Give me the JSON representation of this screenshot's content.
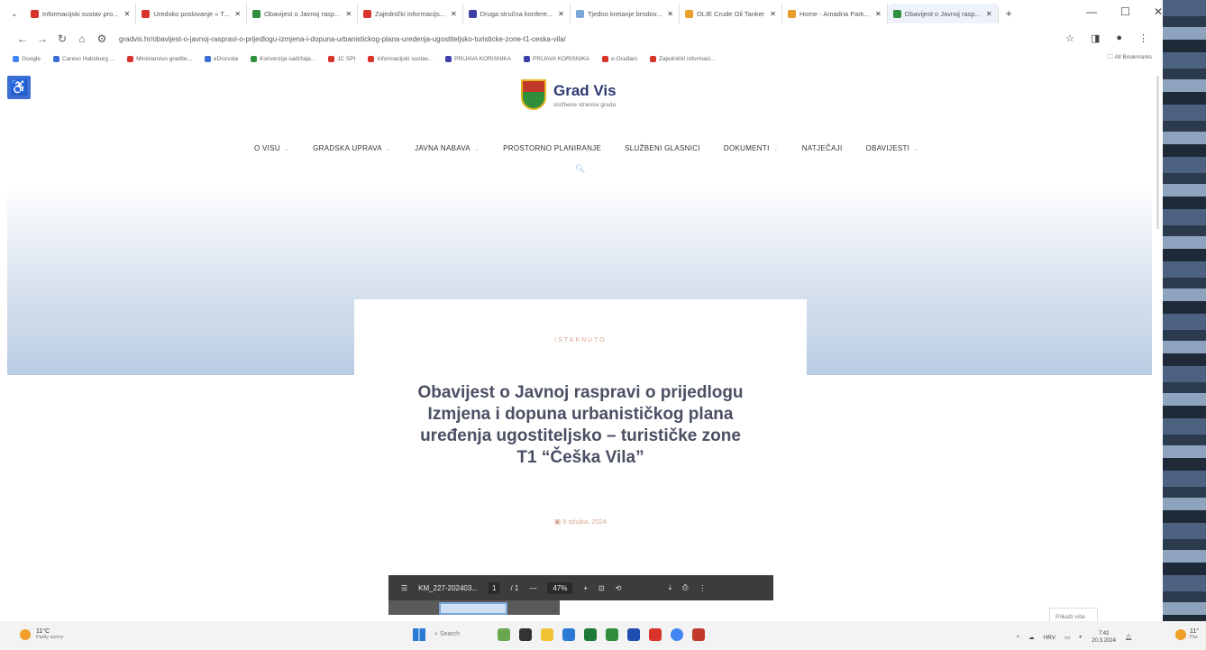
{
  "browser": {
    "tabs": [
      {
        "label": "Informacijski sustav pro...",
        "color": "#d9342b",
        "active": false
      },
      {
        "label": "Uredsko poslovanje » T...",
        "color": "#d9342b",
        "active": false
      },
      {
        "label": "Obavijest o Javnoj rasp...",
        "color": "#2f8f3a",
        "active": false
      },
      {
        "label": "Zajednički informacijs...",
        "color": "#d9342b",
        "active": false
      },
      {
        "label": "Druga stručna konfere...",
        "color": "#3b3fa8",
        "active": false
      },
      {
        "label": "Tjedno kretanje brodov...",
        "color": "#7aa6d8",
        "active": false
      },
      {
        "label": "OLIE Crude Oil Tanker",
        "color": "#e8a02a",
        "active": false
      },
      {
        "label": "Home - Amadria Park...",
        "color": "#e8a02a",
        "active": false
      },
      {
        "label": "Obavijest o Javnoj rasp...",
        "color": "#2f8f3a",
        "active": true
      }
    ],
    "new_tab": "+",
    "window_controls": [
      "—",
      "☐",
      "✕"
    ],
    "url": "gradvis.hr/obavijest-o-javnoj-raspravi-o-prijedlogu-izmjena-i-dopuna-urbanistickog-plana-uredenja-ugostiteljsko-turisticke-zone-t1-ceska-vila/",
    "bookmarks": [
      {
        "label": "Google",
        "color": "#4285f4"
      },
      {
        "label": "Carevo Habsburg ...",
        "color": "#3b6fd6"
      },
      {
        "label": "Ministarstvo gradite...",
        "color": "#d9342b"
      },
      {
        "label": "eDozvola",
        "color": "#3b6fd6"
      },
      {
        "label": "Konverzija sadržaja...",
        "color": "#2f8f3a"
      },
      {
        "label": "JC SPI",
        "color": "#d9342b"
      },
      {
        "label": "Informacijski sustav...",
        "color": "#d9342b"
      },
      {
        "label": "PRIJAVA KORISNIKA",
        "color": "#3b3fa8"
      },
      {
        "label": "PRIJAVA KORISNIKA",
        "color": "#3b3fa8"
      },
      {
        "label": "e-Građani",
        "color": "#d9342b"
      },
      {
        "label": "Zajednički informaci...",
        "color": "#d9342b"
      }
    ],
    "all_bookmarks": "All Bookmarks"
  },
  "site": {
    "title": "Grad Vis",
    "subtitle": "službene stranice grada",
    "nav": [
      {
        "label": "O VISU",
        "has_children": true
      },
      {
        "label": "GRADSKA UPRAVA",
        "has_children": true
      },
      {
        "label": "JAVNA NABAVA",
        "has_children": true
      },
      {
        "label": "PROSTORNO PLANIRANJE",
        "has_children": false
      },
      {
        "label": "SLUŽBENI GLASNICI",
        "has_children": false
      },
      {
        "label": "DOKUMENTI",
        "has_children": true
      },
      {
        "label": "NATJEČAJI",
        "has_children": false
      },
      {
        "label": "OBAVIJESTI",
        "has_children": true
      }
    ],
    "accent": "#2d3a70"
  },
  "article": {
    "kicker": "ISTAKNUTO",
    "title": "Obavijest o Javnoj raspravi o prijedlogu Izmjena i dopuna urbanističkog plana uređenja ugostiteljsko – turističke zone T1 “Češka Vila”",
    "date": "5 ožujka, 2024"
  },
  "pdf_viewer": {
    "filename": "KM_227-202403...",
    "page_current": "1",
    "page_total": "/ 1",
    "zoom": "47%"
  },
  "show_more": "Prikaži više",
  "taskbar": {
    "weather_temp": "11°C",
    "weather_desc": "Partly sunny",
    "search": "Search",
    "language": "HRV",
    "time": "7:42",
    "date": "20.3.2024",
    "weather_temp_2": "11°",
    "weather_desc_2": "Par"
  }
}
